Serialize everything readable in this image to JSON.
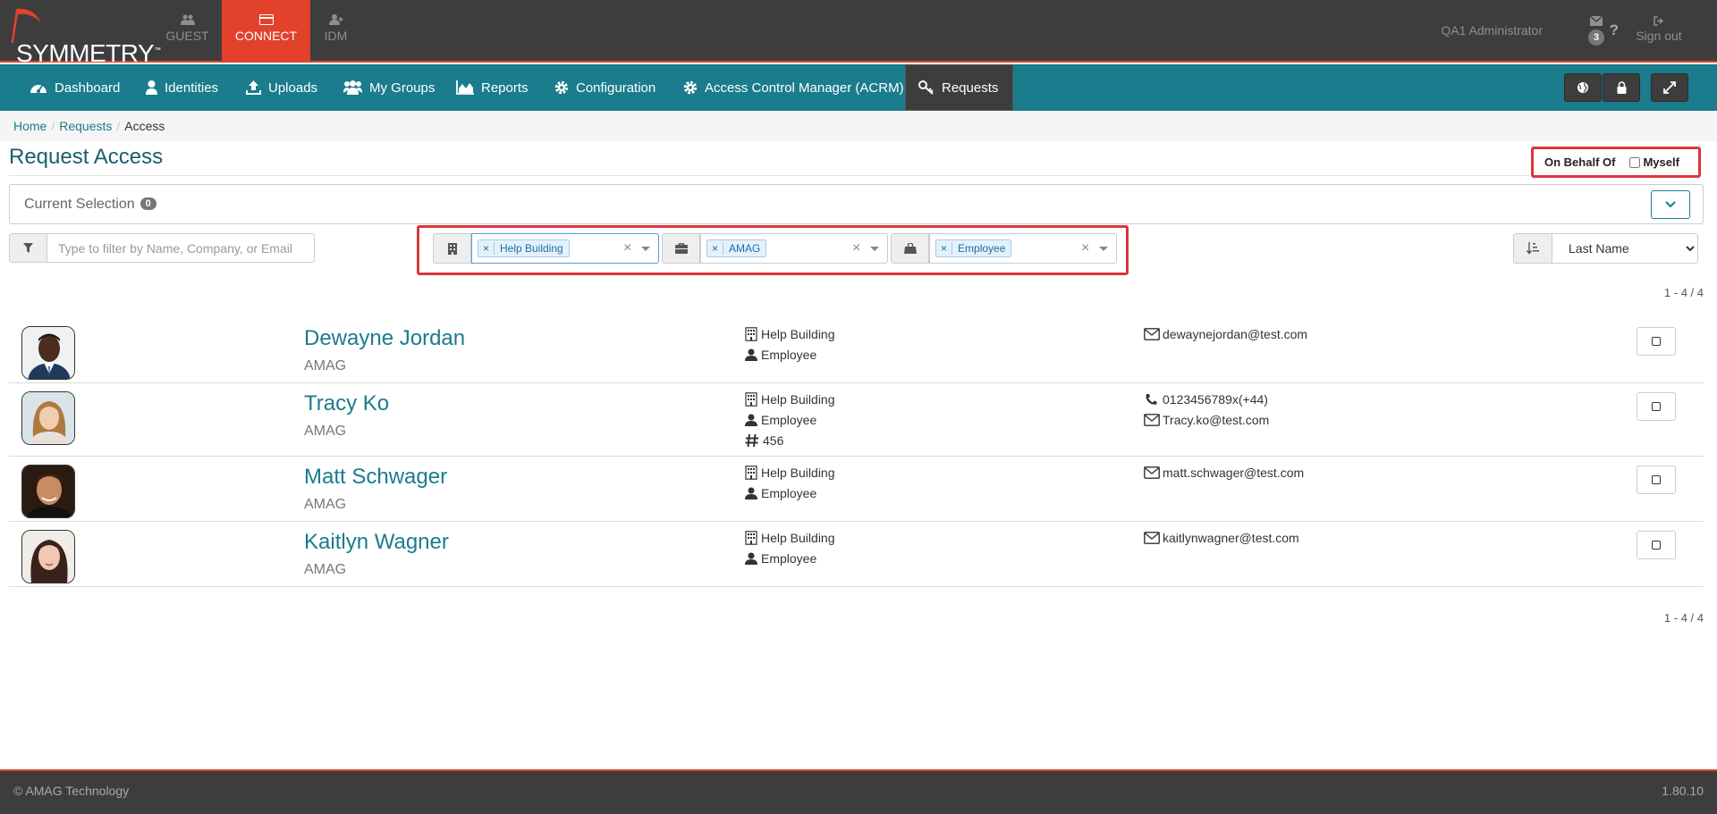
{
  "topbar": {
    "logo_text": "SYMMETRY",
    "logo_tm": "™",
    "apps": [
      {
        "label": "GUEST"
      },
      {
        "label": "CONNECT"
      },
      {
        "label": "IDM"
      }
    ],
    "user_name": "QA1 Administrator",
    "message_count": "3",
    "help": "?",
    "sign_out": "Sign out"
  },
  "nav": {
    "items": [
      {
        "label": "Dashboard"
      },
      {
        "label": "Identities"
      },
      {
        "label": "Uploads"
      },
      {
        "label": "My Groups"
      },
      {
        "label": "Reports"
      },
      {
        "label": "Configuration"
      },
      {
        "label": "Access Control Manager (ACRM)"
      },
      {
        "label": "Requests"
      }
    ]
  },
  "breadcrumb": {
    "home": "Home",
    "requests": "Requests",
    "current": "Access",
    "sep": "/"
  },
  "page": {
    "title": "Request Access",
    "behalf_label": "On Behalf Of",
    "myself_label": "Myself",
    "current_selection_label": "Current Selection",
    "current_selection_count": "0"
  },
  "filters": {
    "search_placeholder": "Type to filter by Name, Company, or Email",
    "building_tag": "Help Building",
    "company_tag": "AMAG",
    "type_tag": "Employee",
    "tag_remove": "×",
    "clear": "×",
    "sort_value": "Last Name"
  },
  "pager": "1 - 4 / 4",
  "people": [
    {
      "name": "Dewayne Jordan",
      "company": "AMAG",
      "building": "Help Building",
      "type": "Employee",
      "email": "dewaynejordan@test.com"
    },
    {
      "name": "Tracy Ko",
      "company": "AMAG",
      "building": "Help Building",
      "type": "Employee",
      "number": "456",
      "phone": "0123456789x(+44)",
      "email": "Tracy.ko@test.com"
    },
    {
      "name": "Matt Schwager",
      "company": "AMAG",
      "building": "Help Building",
      "type": "Employee",
      "email": "matt.schwager@test.com"
    },
    {
      "name": "Kaitlyn Wagner",
      "company": "AMAG",
      "building": "Help Building",
      "type": "Employee",
      "email": "kaitlynwagner@test.com"
    }
  ],
  "footer": {
    "copyright": "© AMAG Technology",
    "version": "1.80.10"
  },
  "colors": {
    "brand_red": "#e2412b",
    "nav_teal": "#1a7c8c",
    "dark": "#3d3d3d",
    "highlight": "#d9363e"
  }
}
